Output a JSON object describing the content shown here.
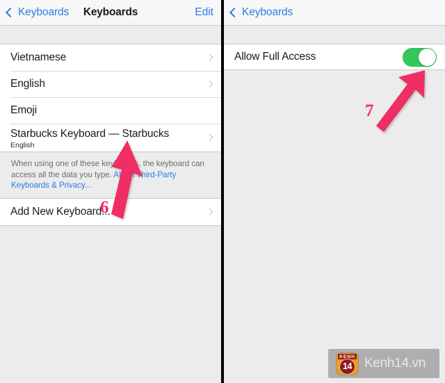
{
  "left_panel": {
    "navbar": {
      "back_label": "Keyboards",
      "title": "Keyboards",
      "edit_label": "Edit"
    },
    "keyboards": [
      {
        "title": "Vietnamese",
        "subtitle": "",
        "chevron": true
      },
      {
        "title": "English",
        "subtitle": "",
        "chevron": true
      },
      {
        "title": "Emoji",
        "subtitle": "",
        "chevron": false
      },
      {
        "title": "Starbucks Keyboard — Starbucks",
        "subtitle": "English",
        "chevron": true
      }
    ],
    "footer_note": {
      "text_before": "When using one of these keyboards, the keyboard can access all the data you type. ",
      "link_text": "About Third-Party Keyboards & Privacy..."
    },
    "add_row": {
      "title": "Add New Keyboard...",
      "chevron": true
    },
    "annotation": {
      "number": "6"
    }
  },
  "right_panel": {
    "navbar": {
      "back_label": "Keyboards"
    },
    "setting_row": {
      "title": "Allow Full Access",
      "toggle_state": "on"
    },
    "annotation": {
      "number": "7"
    }
  },
  "watermark": {
    "logo_top_text": "KENH",
    "logo_number": "14",
    "site_text": "Kenh14.vn"
  },
  "colors": {
    "accent_blue": "#2a7ae2",
    "toggle_green": "#34c85a",
    "annotation_pink": "#ef2d63",
    "group_background": "#ececed",
    "row_background": "#ffffff"
  }
}
